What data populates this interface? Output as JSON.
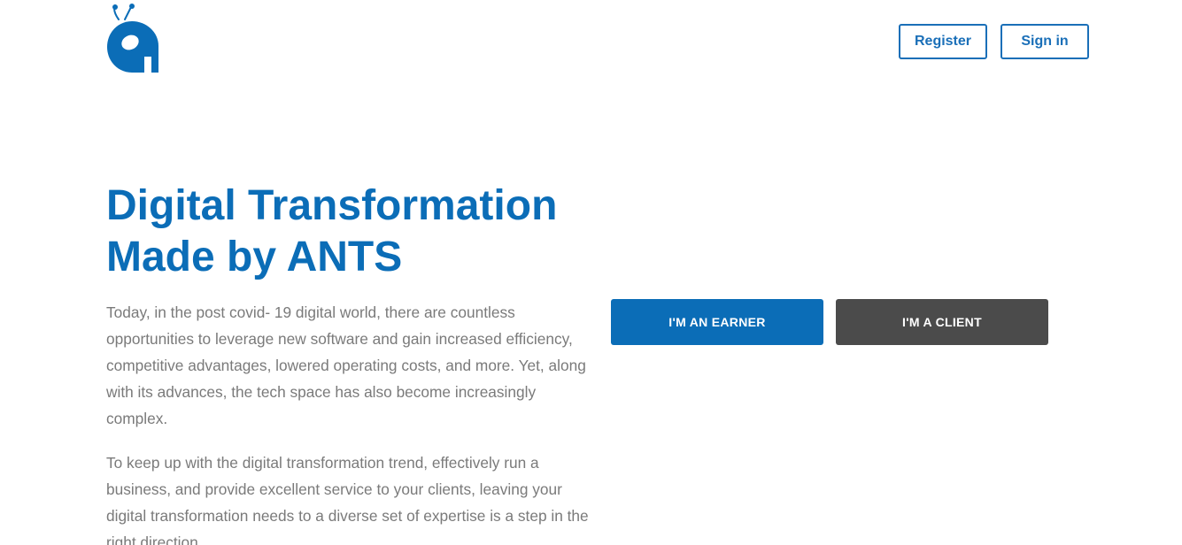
{
  "header": {
    "logo_name": "ants-logo",
    "register_label": "Register",
    "signin_label": "Sign in"
  },
  "hero": {
    "title_line1": "Digital Transformation",
    "title_line2": "Made by ANTS",
    "paragraph1": "Today, in the post covid- 19 digital world, there are countless opportunities to leverage new software and gain increased efficiency, competitive advantages, lowered operating costs, and more. Yet, along with its advances, the tech space has also become increasingly complex.",
    "paragraph2": "To keep up with the digital transformation trend, effectively run a business, and provide excellent service to your clients, leaving your digital transformation needs to a diverse set of expertise is a step in the right direction."
  },
  "cta": {
    "earner_label": "I'M AN EARNER",
    "client_label": "I'M A CLIENT"
  },
  "colors": {
    "brand_blue": "#0b6db7",
    "dark_gray": "#4b4b4b",
    "text_gray": "#7a7a7a"
  }
}
